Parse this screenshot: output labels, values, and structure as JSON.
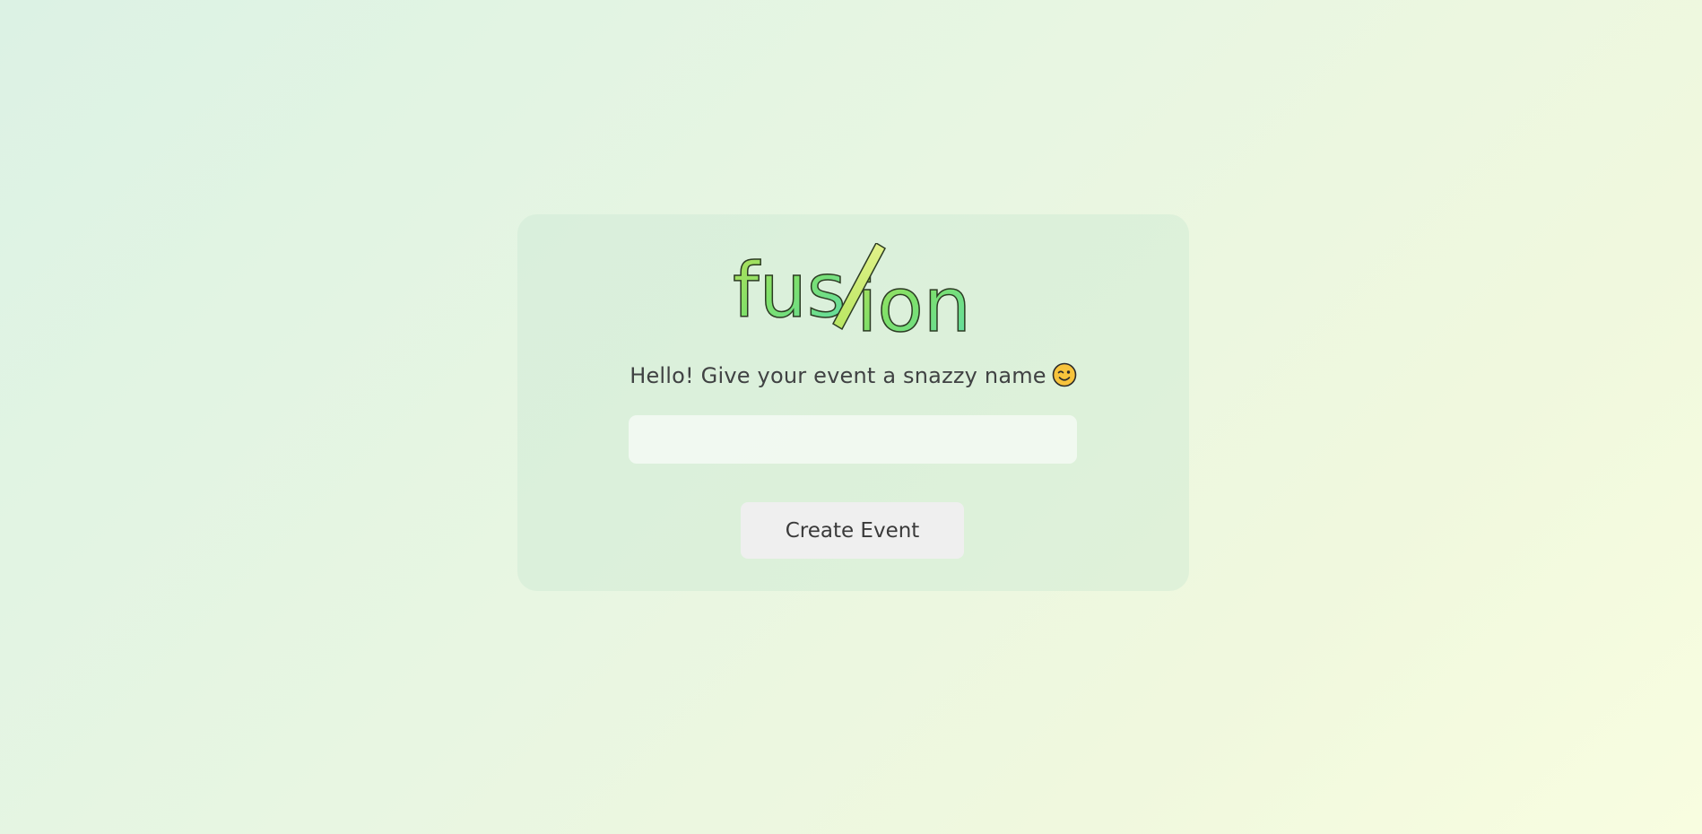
{
  "logo": {
    "text_left": "fus",
    "slash": "/",
    "text_right": "ion",
    "colors": {
      "start": "#9ad94f",
      "mid": "#7ee06a",
      "end": "#5fdc9a",
      "slash": "#d6f07a",
      "outline": "#2c3b23"
    }
  },
  "prompt": {
    "text": "Hello! Give your event a snazzy name",
    "emoji_icon": "winking-face-icon"
  },
  "event_name_input": {
    "value": "",
    "placeholder": ""
  },
  "create_button": {
    "label": "Create Event"
  },
  "colors": {
    "background_start": "#dcf2e4",
    "background_end": "#f8fde0",
    "text": "#404243",
    "button_bg": "#efefef"
  }
}
